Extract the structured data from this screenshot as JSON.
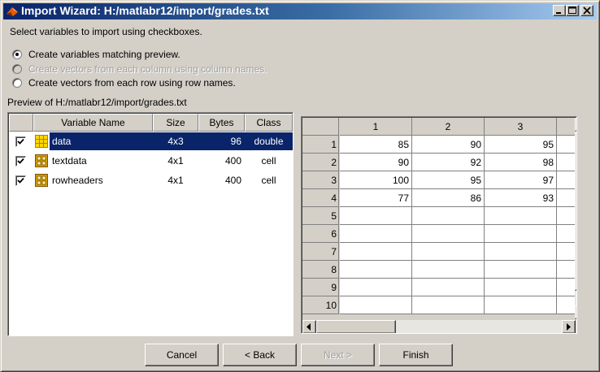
{
  "window": {
    "title": "Import Wizard: H:/matlabr12/import/grades.txt",
    "minimize_icon": "minimize-icon",
    "maximize_icon": "maximize-icon",
    "close_icon": "close-icon",
    "app_icon": "matlab-icon"
  },
  "instructions": "Select variables to import using checkboxes.",
  "options": [
    {
      "label": "Create variables matching preview.",
      "selected": true,
      "enabled": true
    },
    {
      "label": "Create vectors from each column using column names.",
      "selected": false,
      "enabled": false
    },
    {
      "label": "Create vectors from each row using row names.",
      "selected": false,
      "enabled": true
    }
  ],
  "preview_label": "Preview of H:/matlabr12/import/grades.txt",
  "variables": {
    "headers": [
      "Variable Name",
      "Size",
      "Bytes",
      "Class"
    ],
    "rows": [
      {
        "checked": true,
        "icon": "matrix-icon",
        "name": "data",
        "size": "4x3",
        "bytes": "96",
        "class": "double",
        "selected": true
      },
      {
        "checked": true,
        "icon": "cell-array-icon",
        "name": "textdata",
        "size": "4x1",
        "bytes": "400",
        "class": "cell",
        "selected": false
      },
      {
        "checked": true,
        "icon": "cell-array-icon",
        "name": "rowheaders",
        "size": "4x1",
        "bytes": "400",
        "class": "cell",
        "selected": false
      }
    ]
  },
  "grid": {
    "columns": [
      "1",
      "2",
      "3"
    ],
    "row_labels": [
      "1",
      "2",
      "3",
      "4",
      "5",
      "6",
      "7",
      "8",
      "9",
      "10"
    ],
    "cells": [
      [
        "85",
        "90",
        "95"
      ],
      [
        "90",
        "92",
        "98"
      ],
      [
        "100",
        "95",
        "97"
      ],
      [
        "77",
        "86",
        "93"
      ],
      [
        "",
        "",
        ""
      ],
      [
        "",
        "",
        ""
      ],
      [
        "",
        "",
        ""
      ],
      [
        "",
        "",
        ""
      ],
      [
        "",
        "",
        ""
      ],
      [
        "",
        "",
        ""
      ]
    ]
  },
  "buttons": {
    "cancel": "Cancel",
    "back": "< Back",
    "next": "Next >",
    "finish": "Finish"
  },
  "colors": {
    "title_bar": "#0a246a",
    "selection": "#0a246a",
    "face": "#d4d0c8",
    "cell_icon": "#d4a000",
    "matrix_icon": "#ffd700"
  }
}
